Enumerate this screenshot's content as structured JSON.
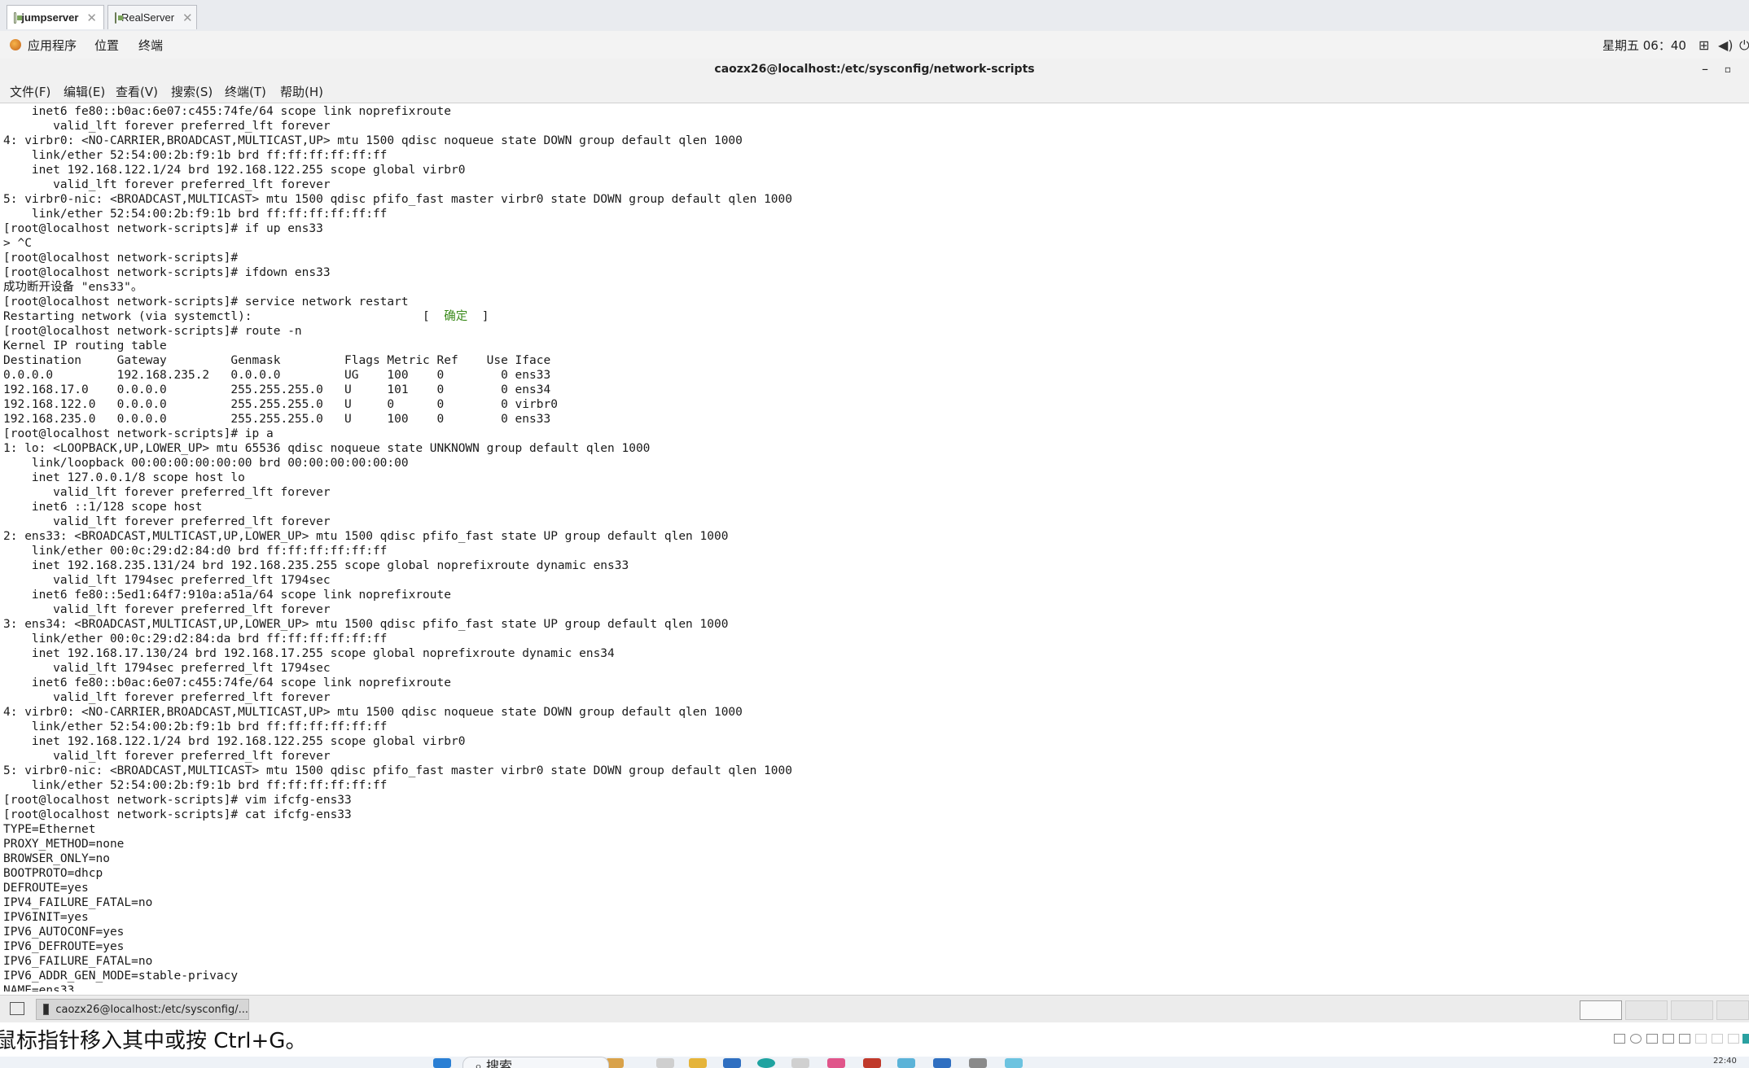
{
  "vm_tabs": [
    {
      "label": "jumpserver",
      "active": true
    },
    {
      "label": "RealServer",
      "active": false
    }
  ],
  "topbar": {
    "menus": [
      "应用程序",
      "位置",
      "终端"
    ],
    "clock": "星期五 06：40",
    "tray_icons": [
      "network-icon",
      "volume-icon",
      "power-icon"
    ]
  },
  "terminal": {
    "title": "caozx26@localhost:/etc/sysconfig/network-scripts",
    "menus": [
      "文件(F)",
      "编辑(E)",
      "查看(V)",
      "搜索(S)",
      "终端(T)",
      "帮助(H)"
    ],
    "lines": [
      "    inet6 fe80::b0ac:6e07:c455:74fe/64 scope link noprefixroute",
      "       valid_lft forever preferred_lft forever",
      "4: virbr0: <NO-CARRIER,BROADCAST,MULTICAST,UP> mtu 1500 qdisc noqueue state DOWN group default qlen 1000",
      "    link/ether 52:54:00:2b:f9:1b brd ff:ff:ff:ff:ff:ff",
      "    inet 192.168.122.1/24 brd 192.168.122.255 scope global virbr0",
      "       valid_lft forever preferred_lft forever",
      "5: virbr0-nic: <BROADCAST,MULTICAST> mtu 1500 qdisc pfifo_fast master virbr0 state DOWN group default qlen 1000",
      "    link/ether 52:54:00:2b:f9:1b brd ff:ff:ff:ff:ff:ff",
      "[root@localhost network-scripts]# if up ens33",
      "> ^C",
      "[root@localhost network-scripts]#",
      "[root@localhost network-scripts]# ifdown ens33",
      "成功断开设备 \"ens33\"。",
      "[root@localhost network-scripts]# service network restart",
      "Restarting network (via systemctl):                        [  确定  ]",
      "[root@localhost network-scripts]# route -n",
      "Kernel IP routing table",
      "Destination     Gateway         Genmask         Flags Metric Ref    Use Iface",
      "0.0.0.0         192.168.235.2   0.0.0.0         UG    100    0        0 ens33",
      "192.168.17.0    0.0.0.0         255.255.255.0   U     101    0        0 ens34",
      "192.168.122.0   0.0.0.0         255.255.255.0   U     0      0        0 virbr0",
      "192.168.235.0   0.0.0.0         255.255.255.0   U     100    0        0 ens33",
      "[root@localhost network-scripts]# ip a",
      "1: lo: <LOOPBACK,UP,LOWER_UP> mtu 65536 qdisc noqueue state UNKNOWN group default qlen 1000",
      "    link/loopback 00:00:00:00:00:00 brd 00:00:00:00:00:00",
      "    inet 127.0.0.1/8 scope host lo",
      "       valid_lft forever preferred_lft forever",
      "    inet6 ::1/128 scope host",
      "       valid_lft forever preferred_lft forever",
      "2: ens33: <BROADCAST,MULTICAST,UP,LOWER_UP> mtu 1500 qdisc pfifo_fast state UP group default qlen 1000",
      "    link/ether 00:0c:29:d2:84:d0 brd ff:ff:ff:ff:ff:ff",
      "    inet 192.168.235.131/24 brd 192.168.235.255 scope global noprefixroute dynamic ens33",
      "       valid_lft 1794sec preferred_lft 1794sec",
      "    inet6 fe80::5ed1:64f7:910a:a51a/64 scope link noprefixroute",
      "       valid_lft forever preferred_lft forever",
      "3: ens34: <BROADCAST,MULTICAST,UP,LOWER_UP> mtu 1500 qdisc pfifo_fast state UP group default qlen 1000",
      "    link/ether 00:0c:29:d2:84:da brd ff:ff:ff:ff:ff:ff",
      "    inet 192.168.17.130/24 brd 192.168.17.255 scope global noprefixroute dynamic ens34",
      "       valid_lft 1794sec preferred_lft 1794sec",
      "    inet6 fe80::b0ac:6e07:c455:74fe/64 scope link noprefixroute",
      "       valid_lft forever preferred_lft forever",
      "4: virbr0: <NO-CARRIER,BROADCAST,MULTICAST,UP> mtu 1500 qdisc noqueue state DOWN group default qlen 1000",
      "    link/ether 52:54:00:2b:f9:1b brd ff:ff:ff:ff:ff:ff",
      "    inet 192.168.122.1/24 brd 192.168.122.255 scope global virbr0",
      "       valid_lft forever preferred_lft forever",
      "5: virbr0-nic: <BROADCAST,MULTICAST> mtu 1500 qdisc pfifo_fast master virbr0 state DOWN group default qlen 1000",
      "    link/ether 52:54:00:2b:f9:1b brd ff:ff:ff:ff:ff:ff",
      "[root@localhost network-scripts]# vim ifcfg-ens33",
      "[root@localhost network-scripts]# cat ifcfg-ens33",
      "TYPE=Ethernet",
      "PROXY_METHOD=none",
      "BROWSER_ONLY=no",
      "BOOTPROTO=dhcp",
      "DEFROUTE=yes",
      "IPV4_FAILURE_FATAL=no",
      "IPV6INIT=yes",
      "IPV6_AUTOCONF=yes",
      "IPV6_DEFROUTE=yes",
      "IPV6_FAILURE_FATAL=no",
      "IPV6_ADDR_GEN_MODE=stable-privacy",
      "NAME=ens33"
    ]
  },
  "taskbar": {
    "item_label": "caozx26@localhost:/etc/sysconfig/..."
  },
  "host": {
    "hint": "鼠标指针移入其中或按 Ctrl+G。",
    "search_label": "搜索",
    "clock_small": "22:40"
  },
  "colors": {
    "ok_text": "#3a8a1a"
  }
}
